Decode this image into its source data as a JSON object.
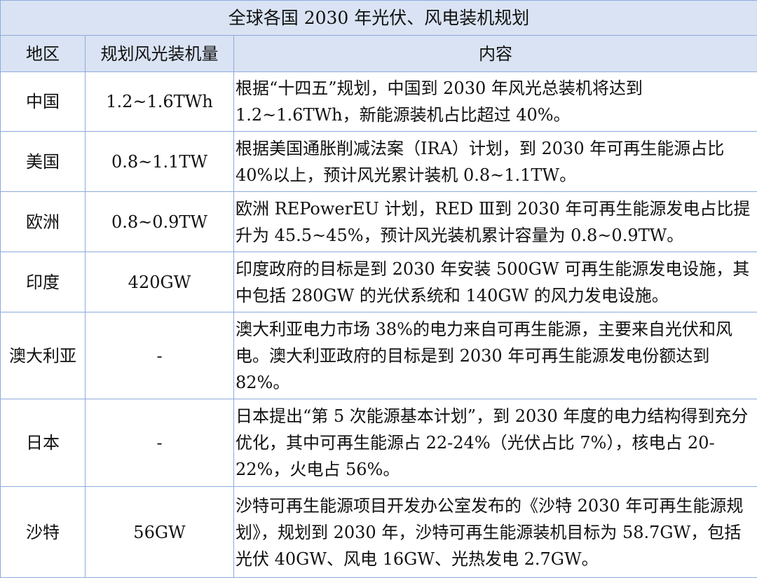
{
  "table": {
    "title": "全球各国 2030 年光伏、风电装机规划",
    "headers": [
      "地区",
      "规划风光装机量",
      "内容"
    ],
    "rows": [
      {
        "region": "中国",
        "capacity": "1.2~1.6TWh",
        "content": "根据“十四五”规划，中国到 2030 年风光总装机将达到 1.2~1.6TWh，新能源装机占比超过 40%。"
      },
      {
        "region": "美国",
        "capacity": "0.8~1.1TW",
        "content": "根据美国通胀削减法案（IRA）计划，到 2030 年可再生能源占比 40%以上，预计风光累计装机 0.8~1.1TW。"
      },
      {
        "region": "欧洲",
        "capacity": "0.8~0.9TW",
        "content": "欧洲 REPowerEU 计划，RED Ⅲ到 2030 年可再生能源发电占比提升为 45.5~45%，预计风光装机累计容量为 0.8~0.9TW。"
      },
      {
        "region": "印度",
        "capacity": "420GW",
        "content": "印度政府的目标是到 2030 年安装 500GW 可再生能源发电设施，其中包括 280GW 的光伏系统和 140GW 的风力发电设施。"
      },
      {
        "region": "澳大利亚",
        "capacity": "-",
        "content": "澳大利亚电力市场 38%的电力来自可再生能源，主要来自光伏和风电。澳大利亚政府的目标是到 2030 年可再生能源发电份额达到 82%。"
      },
      {
        "region": "日本",
        "capacity": "-",
        "content": "日本提出“第 5 次能源基本计划”，到 2030 年度的电力结构得到充分优化，其中可再生能源占 22-24%（光伏占比 7%），核电占 20-22%，火电占 56%。"
      },
      {
        "region": "沙特",
        "capacity": "56GW",
        "content": "沙特可再生能源项目开发办公室发布的《沙特 2030 年可再生能源规划》，规划到 2030 年，沙特可再生能源装机目标为 58.7GW，包括光伏 40GW、风电 16GW、光热发电 2.7GW。"
      }
    ]
  }
}
